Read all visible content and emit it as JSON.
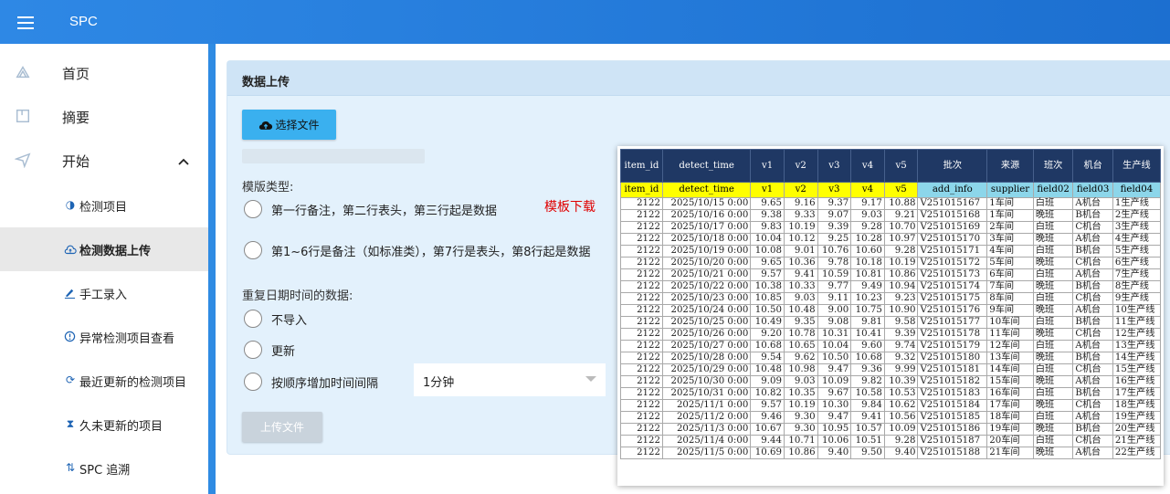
{
  "app": {
    "title": "SPC"
  },
  "sidebar": {
    "items": [
      {
        "label": "首页",
        "icon": "home-icon"
      },
      {
        "label": "摘要",
        "icon": "summary-icon"
      },
      {
        "label": "开始",
        "icon": "send-icon",
        "expanded": true
      }
    ],
    "subitems": [
      {
        "label": "检测项目",
        "icon": "contrast-icon"
      },
      {
        "label": "检测数据上传",
        "icon": "cloud-upload-icon",
        "active": true
      },
      {
        "label": "手工录入",
        "icon": "pen-icon"
      },
      {
        "label": "异常检测项目查看",
        "icon": "alert-circle-icon"
      },
      {
        "label": "最近更新的检测项目",
        "icon": "refresh-icon"
      },
      {
        "label": "久未更新的项目",
        "icon": "hourglass-icon"
      },
      {
        "label": "SPC 追溯",
        "icon": "trace-icon"
      }
    ]
  },
  "panel": {
    "title": "数据上传",
    "choose_file": "选择文件",
    "template_type_label": "模版类型:",
    "template_options": [
      "第一行备注，第二行表头，第三行起是数据",
      "第1~6行是备注（如标准类），第7行是表头，第8行起是数据"
    ],
    "template_download": "模板下载",
    "duplicate_label": "重复日期时间的数据:",
    "duplicate_options": [
      "不导入",
      "更新",
      "按顺序增加时间间隔"
    ],
    "interval_value": "1分钟",
    "upload_button": "上传文件"
  },
  "sheet": {
    "header1": [
      "item_id",
      "detect_time",
      "v1",
      "v2",
      "v3",
      "v4",
      "v5",
      "批次",
      "来源",
      "班次",
      "机台",
      "生产线"
    ],
    "header2": [
      "item_id",
      "detect_time",
      "v1",
      "v2",
      "v3",
      "v4",
      "v5",
      "add_info",
      "supplier",
      "field02",
      "field03",
      "field04"
    ],
    "rows": [
      [
        "2122",
        "2025/10/15 0:00",
        "9.65",
        "9.16",
        "9.37",
        "9.17",
        "10.88",
        "V251015167",
        "1车间",
        "白班",
        "A机台",
        "1生产线"
      ],
      [
        "2122",
        "2025/10/16 0:00",
        "9.38",
        "9.33",
        "9.07",
        "9.03",
        "9.21",
        "V251015168",
        "1车间",
        "晚班",
        "B机台",
        "2生产线"
      ],
      [
        "2122",
        "2025/10/17 0:00",
        "9.83",
        "10.19",
        "9.39",
        "9.28",
        "10.70",
        "V251015169",
        "2车间",
        "白班",
        "C机台",
        "3生产线"
      ],
      [
        "2122",
        "2025/10/18 0:00",
        "10.04",
        "10.12",
        "9.25",
        "10.28",
        "10.97",
        "V251015170",
        "3车间",
        "晚班",
        "A机台",
        "4生产线"
      ],
      [
        "2122",
        "2025/10/19 0:00",
        "10.08",
        "9.01",
        "10.76",
        "10.60",
        "9.28",
        "V251015171",
        "4车间",
        "白班",
        "B机台",
        "5生产线"
      ],
      [
        "2122",
        "2025/10/20 0:00",
        "9.65",
        "10.36",
        "9.78",
        "10.18",
        "10.19",
        "V251015172",
        "5车间",
        "晚班",
        "C机台",
        "6生产线"
      ],
      [
        "2122",
        "2025/10/21 0:00",
        "9.57",
        "9.41",
        "10.59",
        "10.81",
        "10.86",
        "V251015173",
        "6车间",
        "白班",
        "A机台",
        "7生产线"
      ],
      [
        "2122",
        "2025/10/22 0:00",
        "10.38",
        "10.33",
        "9.77",
        "9.49",
        "10.94",
        "V251015174",
        "7车间",
        "晚班",
        "B机台",
        "8生产线"
      ],
      [
        "2122",
        "2025/10/23 0:00",
        "10.85",
        "9.03",
        "9.11",
        "10.23",
        "9.23",
        "V251015175",
        "8车间",
        "白班",
        "C机台",
        "9生产线"
      ],
      [
        "2122",
        "2025/10/24 0:00",
        "10.50",
        "10.48",
        "9.00",
        "10.75",
        "10.90",
        "V251015176",
        "9车间",
        "晚班",
        "A机台",
        "10生产线"
      ],
      [
        "2122",
        "2025/10/25 0:00",
        "10.49",
        "9.35",
        "9.08",
        "9.81",
        "9.58",
        "V251015177",
        "10车间",
        "白班",
        "B机台",
        "11生产线"
      ],
      [
        "2122",
        "2025/10/26 0:00",
        "9.20",
        "10.78",
        "10.31",
        "10.41",
        "9.39",
        "V251015178",
        "11车间",
        "晚班",
        "C机台",
        "12生产线"
      ],
      [
        "2122",
        "2025/10/27 0:00",
        "10.68",
        "10.65",
        "10.04",
        "9.60",
        "9.74",
        "V251015179",
        "12车间",
        "白班",
        "A机台",
        "13生产线"
      ],
      [
        "2122",
        "2025/10/28 0:00",
        "9.54",
        "9.62",
        "10.50",
        "10.68",
        "9.32",
        "V251015180",
        "13车间",
        "晚班",
        "B机台",
        "14生产线"
      ],
      [
        "2122",
        "2025/10/29 0:00",
        "10.48",
        "10.98",
        "9.47",
        "9.36",
        "9.99",
        "V251015181",
        "14车间",
        "白班",
        "C机台",
        "15生产线"
      ],
      [
        "2122",
        "2025/10/30 0:00",
        "9.09",
        "9.03",
        "10.09",
        "9.82",
        "10.39",
        "V251015182",
        "15车间",
        "晚班",
        "A机台",
        "16生产线"
      ],
      [
        "2122",
        "2025/10/31 0:00",
        "10.82",
        "10.35",
        "9.67",
        "10.58",
        "10.53",
        "V251015183",
        "16车间",
        "白班",
        "B机台",
        "17生产线"
      ],
      [
        "2122",
        "2025/11/1 0:00",
        "9.57",
        "10.19",
        "10.30",
        "9.84",
        "10.62",
        "V251015184",
        "17车间",
        "晚班",
        "C机台",
        "18生产线"
      ],
      [
        "2122",
        "2025/11/2 0:00",
        "9.46",
        "9.30",
        "9.47",
        "9.41",
        "10.56",
        "V251015185",
        "18车间",
        "白班",
        "A机台",
        "19生产线"
      ],
      [
        "2122",
        "2025/11/3 0:00",
        "10.67",
        "9.30",
        "10.95",
        "10.57",
        "10.09",
        "V251015186",
        "19车间",
        "晚班",
        "B机台",
        "20生产线"
      ],
      [
        "2122",
        "2025/11/4 0:00",
        "9.44",
        "10.71",
        "10.06",
        "10.51",
        "9.28",
        "V251015187",
        "20车间",
        "白班",
        "C机台",
        "21生产线"
      ],
      [
        "2122",
        "2025/11/5 0:00",
        "10.69",
        "10.86",
        "9.40",
        "9.50",
        "9.40",
        "V251015188",
        "21车间",
        "晚班",
        "A机台",
        "22生产线"
      ]
    ]
  },
  "colors": {
    "topbar": "#2e88e5",
    "accent": "#3ab0ef",
    "sheet_header": "#1f3864",
    "sheet_field_row": "#ffff00",
    "sheet_field_cyan": "#8cd6ea",
    "download_link": "#e00000"
  }
}
